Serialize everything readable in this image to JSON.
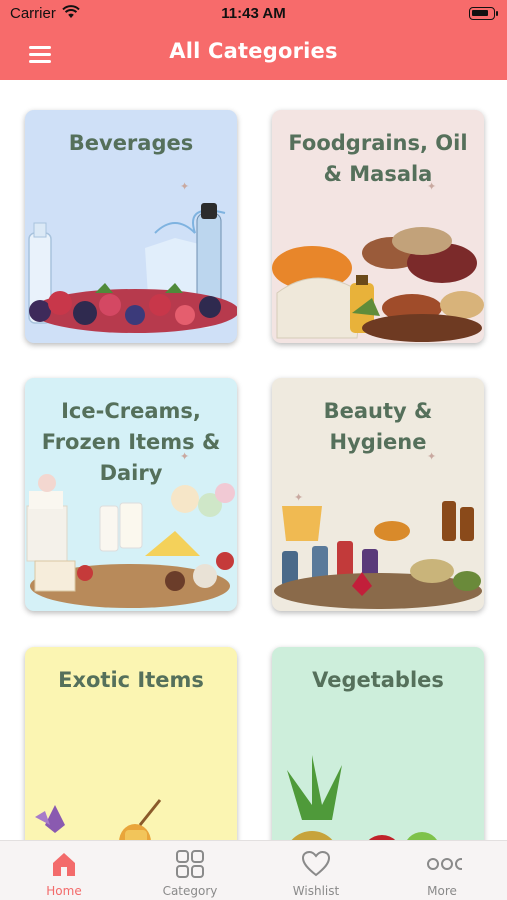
{
  "status_bar": {
    "carrier": "Carrier",
    "time": "11:43 AM"
  },
  "header": {
    "title": "All Categories",
    "menu_icon": "hamburger-menu-icon"
  },
  "categories": [
    {
      "label": "Beverages",
      "bg": "#cfe0f7"
    },
    {
      "label": "Foodgrains, Oil & Masala",
      "bg": "#f3e4e2"
    },
    {
      "label": "Ice-Creams, Frozen Items & Dairy",
      "bg": "#d5f1f7"
    },
    {
      "label": "Beauty & Hygiene",
      "bg": "#efeadf"
    },
    {
      "label": "Exotic Items",
      "bg": "#fbf5b2"
    },
    {
      "label": "Vegetables",
      "bg": "#cdeedb"
    }
  ],
  "tabbar": {
    "tabs": [
      {
        "label": "Home",
        "icon": "home-icon",
        "active": true
      },
      {
        "label": "Category",
        "icon": "grid-icon",
        "active": false
      },
      {
        "label": "Wishlist",
        "icon": "heart-icon",
        "active": false
      },
      {
        "label": "More",
        "icon": "more-dots-icon",
        "active": false
      }
    ]
  },
  "colors": {
    "header": "#f76b6b",
    "accent": "#f36b6b",
    "card_text": "#55705b",
    "tab_inactive": "#8a8a8a"
  }
}
